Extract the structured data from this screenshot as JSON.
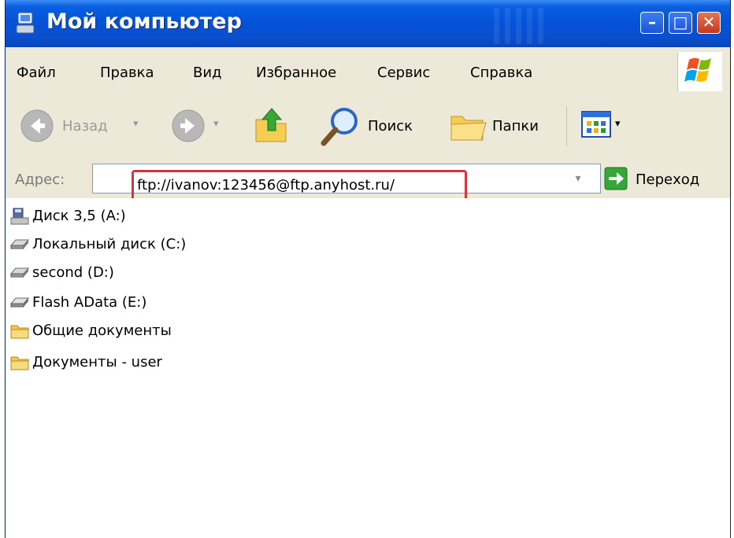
{
  "window": {
    "title": "Мой компьютер",
    "colors": {
      "titlebar": "#0453d9",
      "chrome": "#ece9d8",
      "address_highlight": "#d9333f"
    }
  },
  "window_controls": {
    "minimize": "–",
    "maximize": "□",
    "close": "✕"
  },
  "menubar": {
    "items": [
      "Файл",
      "Правка",
      "Вид",
      "Избранное",
      "Сервис",
      "Справка"
    ]
  },
  "toolbar": {
    "back_label": "Назад",
    "search_label": "Поиск",
    "folders_label": "Папки"
  },
  "address": {
    "label": "Адрес:",
    "value": "ftp://ivanov:123456@ftp.anyhost.ru/",
    "go_label": "Переход"
  },
  "items": [
    {
      "label": "Диск 3,5 (A:)",
      "icon": "floppy-drive-icon"
    },
    {
      "label": "Локальный диск (C:)",
      "icon": "hard-disk-icon"
    },
    {
      "label": "second (D:)",
      "icon": "hard-disk-icon"
    },
    {
      "label": "Flash AData (E:)",
      "icon": "removable-drive-icon"
    },
    {
      "label": "Общие документы",
      "icon": "folder-icon"
    },
    {
      "label": "Документы - user",
      "icon": "folder-icon"
    }
  ]
}
